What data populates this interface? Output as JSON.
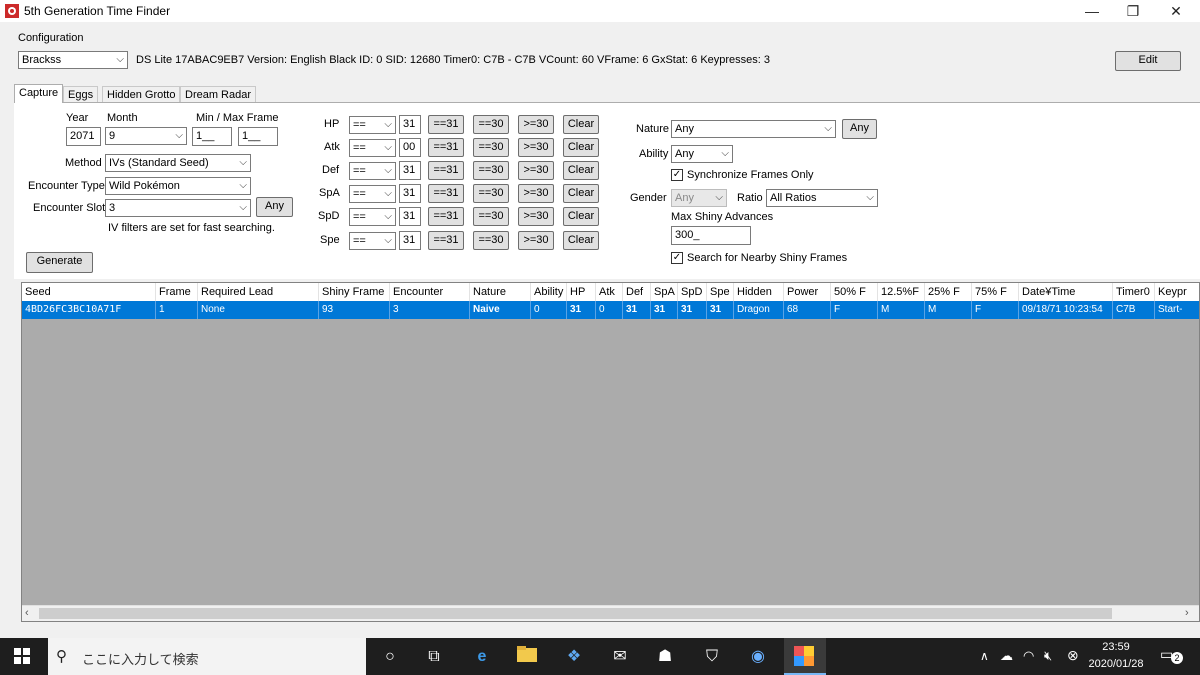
{
  "window": {
    "title": "5th Generation Time Finder",
    "minimize": "—",
    "maximize": "❐",
    "close": "✕"
  },
  "config": {
    "group_label": "Configuration",
    "profile": "Brackss",
    "info": "DS Lite 17ABAC9EB7 Version: English Black ID: 0 SID: 12680 Timer0: C7B - C7B VCount: 60 VFrame: 6 GxStat: 6 Keypresses: 3",
    "edit_label": "Edit"
  },
  "tabs": [
    "Capture",
    "Eggs",
    "Hidden Grotto",
    "Dream Radar"
  ],
  "capture": {
    "year_label": "Year",
    "month_label": "Month",
    "minmax_label": "Min / Max Frame",
    "year_value": "2071",
    "month_value": "9",
    "min_frame": "1__",
    "max_frame": "1__",
    "method_label": "Method",
    "method_value": "IVs (Standard Seed)",
    "encounter_type_label": "Encounter Type",
    "encounter_type_value": "Wild Pokémon",
    "encounter_slot_label": "Encounter Slot",
    "encounter_slot_value": "3",
    "any_label": "Any",
    "iv_note": "IV filters are set for fast searching.",
    "generate_label": "Generate",
    "ivs": [
      {
        "stat": "HP",
        "op": "==",
        "value": "31"
      },
      {
        "stat": "Atk",
        "op": "==",
        "value": "00"
      },
      {
        "stat": "Def",
        "op": "==",
        "value": "31"
      },
      {
        "stat": "SpA",
        "op": "==",
        "value": "31"
      },
      {
        "stat": "SpD",
        "op": "==",
        "value": "31"
      },
      {
        "stat": "Spe",
        "op": "==",
        "value": "31"
      }
    ],
    "iv_btn_31": "==31",
    "iv_btn_30": "==30",
    "iv_btn_ge30": ">=30",
    "iv_btn_clear": "Clear",
    "nature_label": "Nature",
    "nature_value": "Any",
    "nature_any": "Any",
    "ability_label": "Ability",
    "ability_value": "Any",
    "sync_label": "Synchronize Frames Only",
    "gender_label": "Gender",
    "gender_value": "Any",
    "ratio_label": "Ratio",
    "ratio_value": "All Ratios",
    "max_shiny_label": "Max Shiny Advances",
    "max_shiny_value": "300_",
    "nearby_label": "Search for Nearby Shiny Frames"
  },
  "grid": {
    "columns": [
      "Seed",
      "Frame",
      "Required Lead",
      "Shiny Frame",
      "Encounter",
      "Nature",
      "Ability",
      "HP",
      "Atk",
      "Def",
      "SpA",
      "SpD",
      "Spe",
      "Hidden",
      "Power",
      "50% F",
      "12.5%F",
      "25% F",
      "75% F",
      "Date¥Time",
      "Timer0",
      "Keypr"
    ],
    "row": [
      "4BD26FC3BC10A71F",
      "1",
      "None",
      "93",
      "3",
      "Naive",
      "0",
      "31",
      "0",
      "31",
      "31",
      "31",
      "31",
      "Dragon",
      "68",
      "F",
      "M",
      "M",
      "F",
      "09/18/71 10:23:54",
      "C7B",
      "Start-"
    ]
  },
  "taskbar": {
    "search_placeholder": "ここに入力して検索",
    "time": "23:59",
    "date": "2020/01/28",
    "notifications": "2"
  }
}
